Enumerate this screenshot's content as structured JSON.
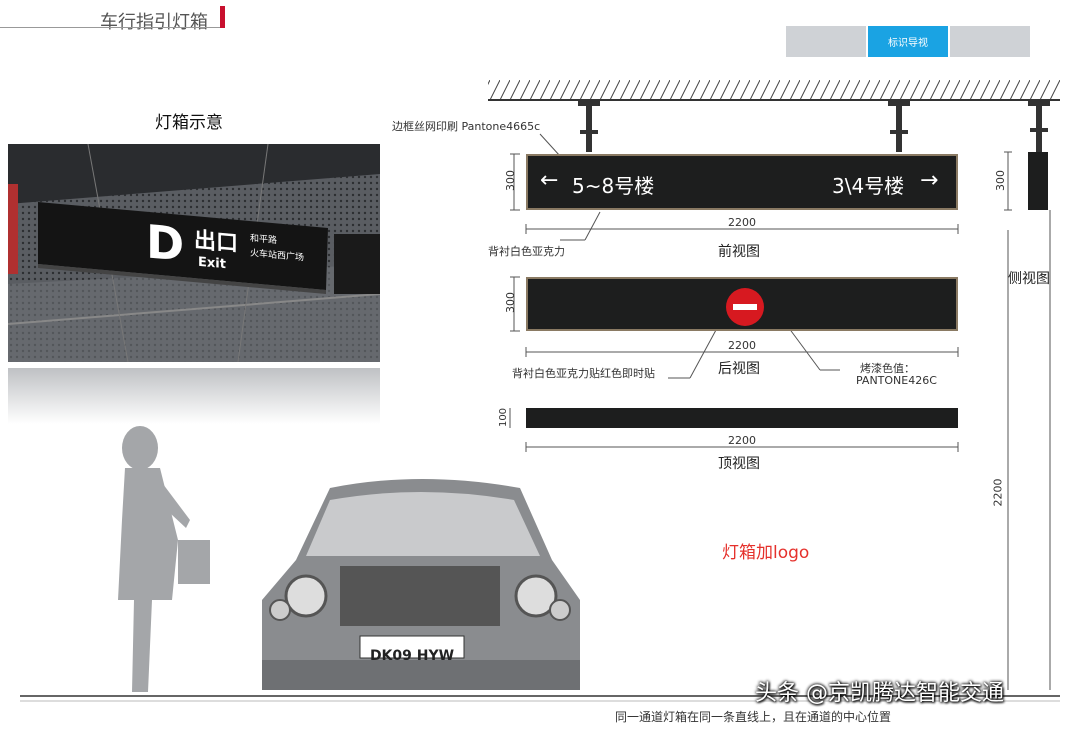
{
  "header": {
    "title": "车行指引灯箱"
  },
  "tabs": [
    "",
    "标识导视",
    ""
  ],
  "demo": {
    "label": "灯箱示意",
    "sign_letter": "D",
    "sign_cn": "出口",
    "sign_en": "Exit",
    "sign_line1": "和平路",
    "sign_line2": "火车站西广场"
  },
  "front": {
    "callout_border": "边框丝网印刷 Pantone4665c",
    "left_text": "5~8号楼",
    "right_text": "3\\4号楼",
    "height_dim": "300",
    "width_dim": "2200",
    "callout_back": "背衬白色亚克力",
    "view_label": "前视图"
  },
  "back": {
    "height_dim": "300",
    "width_dim": "2200",
    "callout_back": "背衬白色亚克力贴红色即时贴",
    "view_label": "后视图",
    "paint_label": "烤漆色值：",
    "paint_code": "PANTONE426C"
  },
  "top": {
    "height_dim": "100",
    "width_dim": "2200",
    "view_label": "顶视图"
  },
  "side": {
    "height_dim": "300",
    "total_dim": "2200",
    "view_label": "侧视图"
  },
  "car": {
    "plate": "DK09 HYW"
  },
  "logo_note": "灯箱加logo",
  "footer": "同一通道灯箱在同一条直线上，且在通道的中心位置",
  "watermark": "头条 @京凯腾达智能交通",
  "colors": {
    "accent_red": "#c8102e",
    "tab_blue": "#1aa3e3",
    "sign_dark": "#1d1e1e",
    "border_gold": "#8a7a63",
    "note_red": "#e5312c"
  }
}
